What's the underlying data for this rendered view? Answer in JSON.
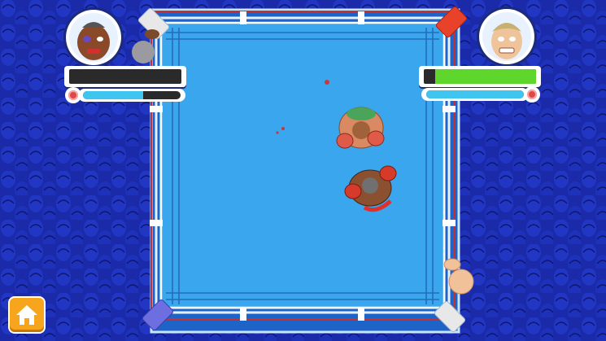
{
  "game": {
    "player_left": {
      "portrait": "bald-boxer-black-eye-portrait",
      "health_fraction": 0.0,
      "stamina_fraction": 0.62,
      "health_bar_color": "#5fd62b",
      "stamina_bar_color": "#3fc5f0"
    },
    "player_right": {
      "portrait": "blond-boxer-grimace-portrait",
      "health_fraction": 0.9,
      "stamina_fraction": 1.0,
      "health_bar_color": "#5fd62b",
      "stamina_bar_color": "#3fc5f0"
    },
    "colors": {
      "crowd": "#1f33b8",
      "crowd_dark": "#0e1a6e",
      "canvas": "#3ba7ef",
      "ropes": "#ffffff",
      "corner_red": "#e8432a",
      "corner_blue": "#6d6ee0",
      "corner_white": "#e8e8e8"
    },
    "home_button": {
      "icon": "home-icon",
      "color": "#f7a51c"
    }
  }
}
